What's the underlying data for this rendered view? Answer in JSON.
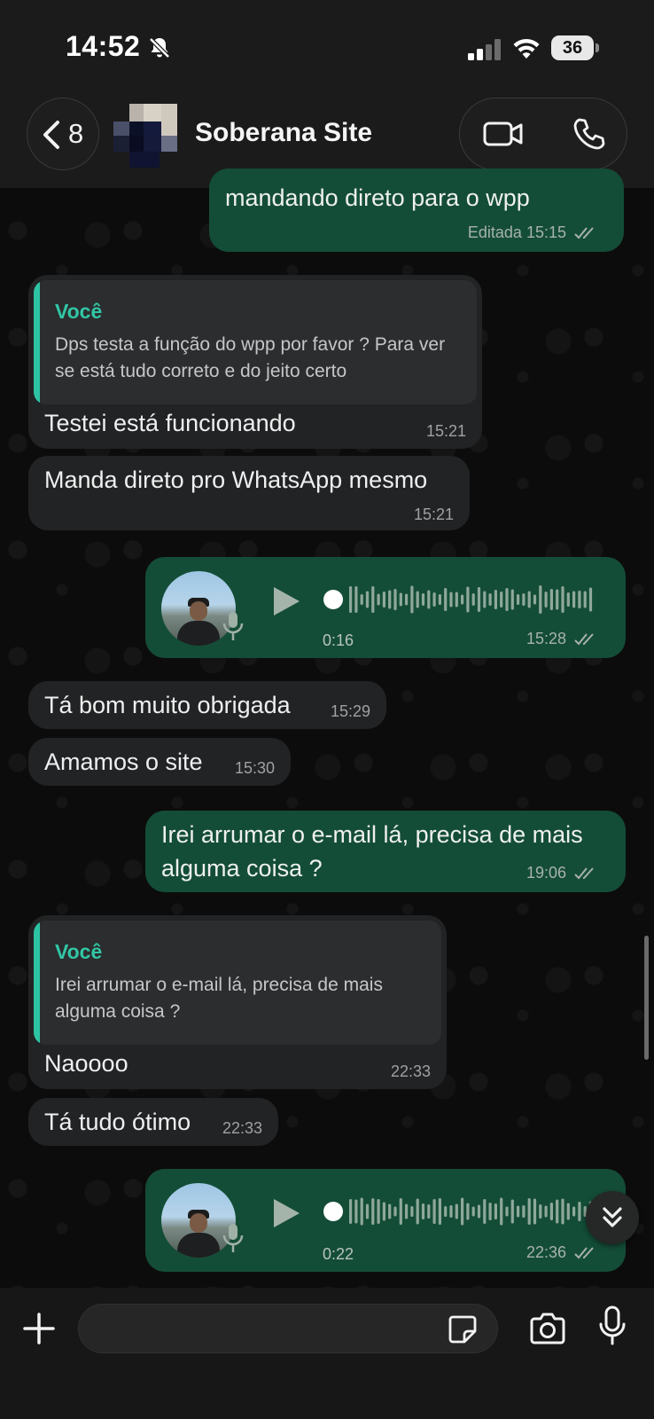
{
  "status_bar": {
    "time": "14:52",
    "battery": "36"
  },
  "header": {
    "back_count": "8",
    "contact_name": "Soberana Site"
  },
  "messages": [
    {
      "text": "mandando direto para o wpp",
      "meta": "Editada 15:15"
    },
    {
      "quote_author": "Você",
      "quote_text": "Dps testa a função do wpp por favor ? Para ver se está tudo correto e do jeito certo",
      "text": "Testei está funcionando",
      "time": "15:21"
    },
    {
      "text": "Manda direto pro WhatsApp mesmo",
      "time": "15:21"
    },
    {
      "duration": "0:16",
      "time": "15:28"
    },
    {
      "text": "Tá bom muito obrigada",
      "time": "15:29"
    },
    {
      "text": "Amamos o site",
      "time": "15:30"
    },
    {
      "text": "Irei arrumar o e-mail lá, precisa de mais alguma coisa ?",
      "time": "19:06"
    },
    {
      "quote_author": "Você",
      "quote_text": "Irei arrumar o e-mail lá, precisa de mais alguma coisa ?",
      "text": "Naoooo",
      "time": "22:33"
    },
    {
      "text": "Tá tudo ótimo",
      "time": "22:33"
    },
    {
      "duration": "0:22",
      "time": "22:36"
    }
  ],
  "input": {
    "placeholder": ""
  },
  "colors": {
    "outgoing": "#144d37",
    "incoming": "#222324",
    "quote_accent": "#2dc4a3",
    "read_ticks": "#a7b2ac"
  }
}
